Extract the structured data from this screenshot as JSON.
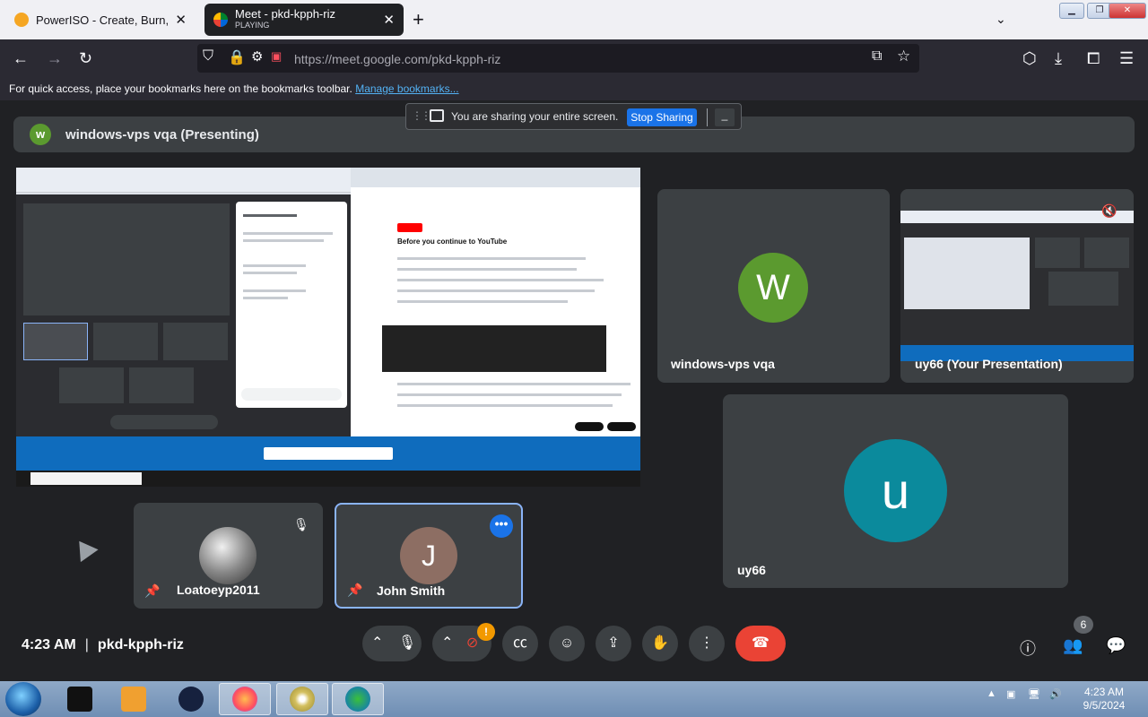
{
  "browser": {
    "tabs": [
      {
        "title": "PowerISO - Create, Burn, Moun",
        "subtitle": ""
      },
      {
        "title": "Meet - pkd-kpph-riz",
        "subtitle": "PLAYING"
      }
    ],
    "url_host": "https://meet.google.com",
    "url_path": "/pkd-kpph-riz",
    "bookmarks_text": "For quick access, place your bookmarks here on the bookmarks toolbar.",
    "bookmarks_link": "Manage bookmarks..."
  },
  "sharing": {
    "text": "You are sharing your entire screen.",
    "stop_label": "Stop Sharing",
    "min_label": "_"
  },
  "presenter": {
    "initial": "w",
    "label": "windows-vps vqa (Presenting)"
  },
  "participants": [
    {
      "name": "windows-vps vqa",
      "initial": "W",
      "color": "#5b9a2f"
    },
    {
      "name": "uy66 (Your Presentation)"
    },
    {
      "name": "uy66",
      "initial": "u",
      "color": "#0b8a9c"
    },
    {
      "name": "Loatoeyp2011"
    },
    {
      "name": "John Smith",
      "initial": "J",
      "color": "#8d6e63"
    }
  ],
  "meeting": {
    "time": "4:23 AM",
    "code": "pkd-kpph-riz",
    "people_count": "6",
    "camera_alert": "!"
  },
  "screen_share": {
    "youtube_title": "Before you continue to YouTube"
  },
  "taskbar": {
    "time": "4:23 AM",
    "date": "9/5/2024"
  },
  "colors": {
    "accent": "#1a73e8",
    "end_call": "#ea4335",
    "tile": "#3c4043",
    "background": "#202124"
  }
}
